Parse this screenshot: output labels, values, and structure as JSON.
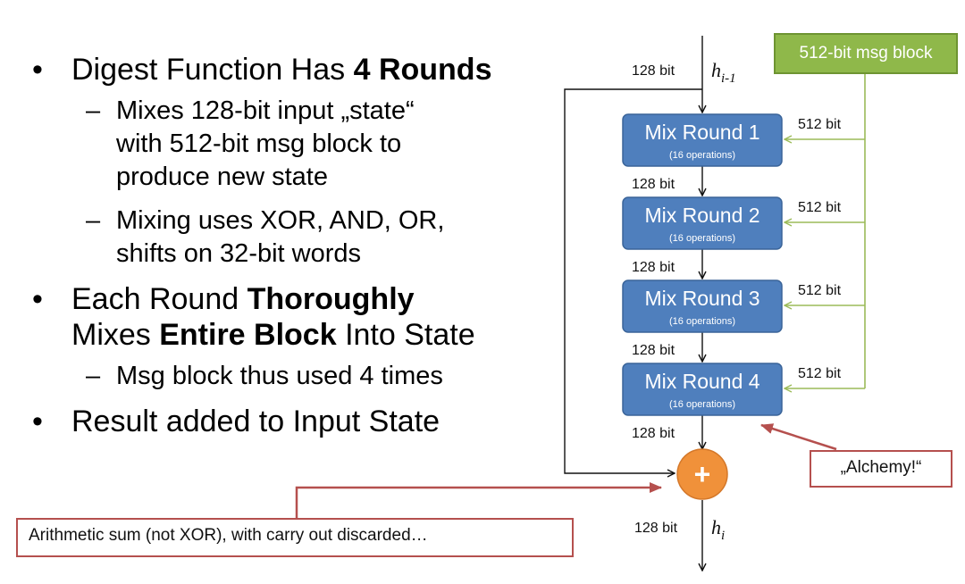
{
  "bullets": [
    {
      "type": "main",
      "parts": [
        {
          "text": "Digest Function Has ",
          "bold": false
        },
        {
          "text": "4 Rounds",
          "bold": true
        }
      ]
    },
    {
      "type": "sub",
      "lines": [
        "Mixes 128-bit input „state“",
        "with 512-bit msg block to",
        "produce new state"
      ]
    },
    {
      "type": "sub",
      "lines": [
        "Mixing uses XOR, AND, OR,",
        "shifts on 32-bit words"
      ]
    },
    {
      "type": "main",
      "line1": [
        {
          "text": "Each Round ",
          "bold": false
        },
        {
          "text": "Thoroughly",
          "bold": true
        }
      ],
      "line2": [
        {
          "text": "Mixes ",
          "bold": false
        },
        {
          "text": "Entire Block",
          "bold": true
        },
        {
          "text": " Into State",
          "bold": false
        }
      ]
    },
    {
      "type": "sub",
      "lines": [
        "Msg block thus used 4 times"
      ]
    },
    {
      "type": "main",
      "parts": [
        {
          "text": "Result added to Input State",
          "bold": false
        }
      ]
    }
  ],
  "diagram": {
    "msg_block_label": "512-bit msg block",
    "input_label": "h",
    "input_sub": "i-1",
    "output_label": "h",
    "output_sub": "i",
    "state_width_label": "128 bit",
    "block_width_label": "512 bit",
    "rounds": [
      {
        "title": "Mix Round 1",
        "subtitle": "(16 operations)"
      },
      {
        "title": "Mix Round 2",
        "subtitle": "(16 operations)"
      },
      {
        "title": "Mix Round 3",
        "subtitle": "(16 operations)"
      },
      {
        "title": "Mix Round 4",
        "subtitle": "(16 operations)"
      }
    ],
    "adder_symbol": "+"
  },
  "callouts": {
    "alchemy": "„Alchemy!“",
    "sum_note": "Arithmetic sum (not XOR), with carry out discarded…"
  },
  "colors": {
    "round_box": "#4f7fbd",
    "msg_block": "#8fb84a",
    "adder": "#f0913a",
    "callout_border": "#b5504e"
  }
}
